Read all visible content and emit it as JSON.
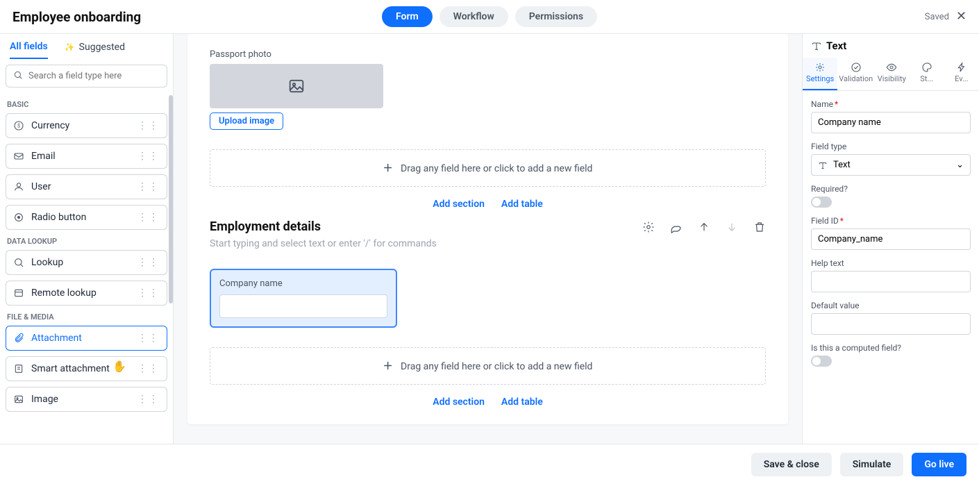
{
  "header": {
    "title": "Employee onboarding",
    "views": [
      "Form",
      "Workflow",
      "Permissions"
    ],
    "saved": "Saved"
  },
  "left": {
    "tabs": {
      "all": "All fields",
      "suggested": "Suggested"
    },
    "search_placeholder": "Search a field type here",
    "groups": [
      {
        "label": "BASIC",
        "items": [
          "Currency",
          "Email",
          "User",
          "Radio button"
        ]
      },
      {
        "label": "DATA LOOKUP",
        "items": [
          "Lookup",
          "Remote lookup"
        ]
      },
      {
        "label": "FILE & MEDIA",
        "items": [
          "Attachment",
          "Smart attachment",
          "Image"
        ]
      }
    ]
  },
  "center": {
    "passport_label": "Passport photo",
    "upload": "Upload image",
    "drag_hint": "Drag any field here or click to add a new field",
    "add_section": "Add section",
    "add_table": "Add table",
    "section_title": "Employment details",
    "section_sub_placeholder": "Start typing and select text or enter '/' for commands",
    "selected_field_label": "Company name"
  },
  "right": {
    "title": "Text",
    "tabs": [
      "Settings",
      "Validation",
      "Visibility",
      "St...",
      "Ev..."
    ],
    "name_label": "Name",
    "name_value": "Company name",
    "fieldtype_label": "Field type",
    "fieldtype_value": "Text",
    "required_label": "Required?",
    "fieldid_label": "Field ID",
    "fieldid_value": "Company_name",
    "helptext_label": "Help text",
    "default_label": "Default value",
    "computed_label": "Is this a computed field?"
  },
  "bottom": {
    "save": "Save & close",
    "simulate": "Simulate",
    "golive": "Go live"
  }
}
